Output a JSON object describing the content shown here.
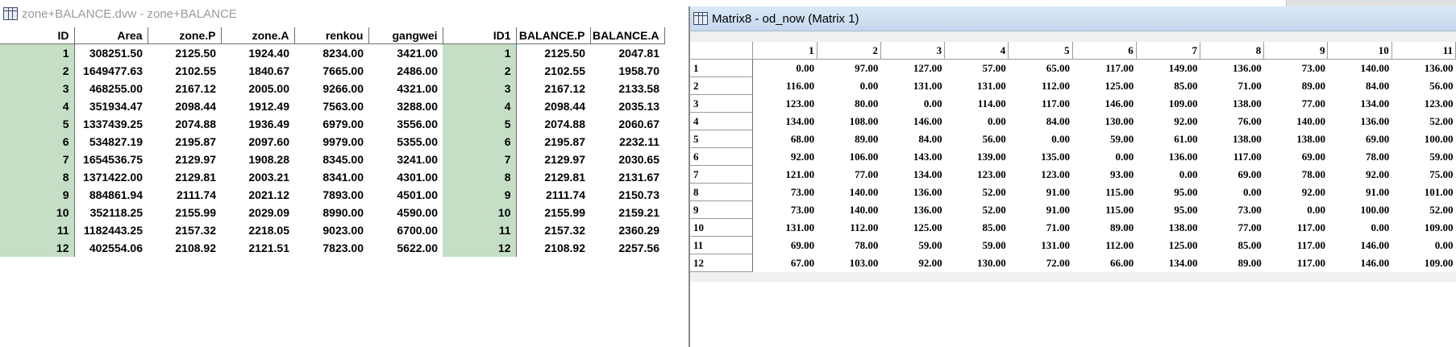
{
  "left_window": {
    "title": "zone+BALANCE.dvw - zone+BALANCE",
    "columns": [
      "ID",
      "Area",
      "zone.P",
      "zone.A",
      "renkou",
      "gangwei",
      "ID1",
      "BALANCE.P",
      "BALANCE.A"
    ],
    "rows": [
      [
        "1",
        "308251.50",
        "2125.50",
        "1924.40",
        "8234.00",
        "3421.00",
        "1",
        "2125.50",
        "2047.81"
      ],
      [
        "2",
        "1649477.63",
        "2102.55",
        "1840.67",
        "7665.00",
        "2486.00",
        "2",
        "2102.55",
        "1958.70"
      ],
      [
        "3",
        "468255.00",
        "2167.12",
        "2005.00",
        "9266.00",
        "4321.00",
        "3",
        "2167.12",
        "2133.58"
      ],
      [
        "4",
        "351934.47",
        "2098.44",
        "1912.49",
        "7563.00",
        "3288.00",
        "4",
        "2098.44",
        "2035.13"
      ],
      [
        "5",
        "1337439.25",
        "2074.88",
        "1936.49",
        "6979.00",
        "3556.00",
        "5",
        "2074.88",
        "2060.67"
      ],
      [
        "6",
        "534827.19",
        "2195.87",
        "2097.60",
        "9979.00",
        "5355.00",
        "6",
        "2195.87",
        "2232.11"
      ],
      [
        "7",
        "1654536.75",
        "2129.97",
        "1908.28",
        "8345.00",
        "3241.00",
        "7",
        "2129.97",
        "2030.65"
      ],
      [
        "8",
        "1371422.00",
        "2129.81",
        "2003.21",
        "8341.00",
        "4301.00",
        "8",
        "2129.81",
        "2131.67"
      ],
      [
        "9",
        "884861.94",
        "2111.74",
        "2021.12",
        "7893.00",
        "4501.00",
        "9",
        "2111.74",
        "2150.73"
      ],
      [
        "10",
        "352118.25",
        "2155.99",
        "2029.09",
        "8990.00",
        "4590.00",
        "10",
        "2155.99",
        "2159.21"
      ],
      [
        "11",
        "1182443.25",
        "2157.32",
        "2218.05",
        "9023.00",
        "6700.00",
        "11",
        "2157.32",
        "2360.29"
      ],
      [
        "12",
        "402554.06",
        "2108.92",
        "2121.51",
        "7823.00",
        "5622.00",
        "12",
        "2108.92",
        "2257.56"
      ]
    ]
  },
  "right_window": {
    "title": "Matrix8 - od_now (Matrix 1)",
    "columns": [
      "1",
      "2",
      "3",
      "4",
      "5",
      "6",
      "7",
      "8",
      "9",
      "10",
      "11"
    ],
    "row_labels": [
      "1",
      "2",
      "3",
      "4",
      "5",
      "6",
      "7",
      "8",
      "9",
      "10",
      "11",
      "12"
    ],
    "rows": [
      [
        "0.00",
        "97.00",
        "127.00",
        "57.00",
        "65.00",
        "117.00",
        "149.00",
        "136.00",
        "73.00",
        "140.00",
        "136.00"
      ],
      [
        "116.00",
        "0.00",
        "131.00",
        "131.00",
        "112.00",
        "125.00",
        "85.00",
        "71.00",
        "89.00",
        "84.00",
        "56.00"
      ],
      [
        "123.00",
        "80.00",
        "0.00",
        "114.00",
        "117.00",
        "146.00",
        "109.00",
        "138.00",
        "77.00",
        "134.00",
        "123.00"
      ],
      [
        "134.00",
        "108.00",
        "146.00",
        "0.00",
        "84.00",
        "130.00",
        "92.00",
        "76.00",
        "140.00",
        "136.00",
        "52.00"
      ],
      [
        "68.00",
        "89.00",
        "84.00",
        "56.00",
        "0.00",
        "59.00",
        "61.00",
        "138.00",
        "138.00",
        "69.00",
        "100.00"
      ],
      [
        "92.00",
        "106.00",
        "143.00",
        "139.00",
        "135.00",
        "0.00",
        "136.00",
        "117.00",
        "69.00",
        "78.00",
        "59.00"
      ],
      [
        "121.00",
        "77.00",
        "134.00",
        "123.00",
        "123.00",
        "93.00",
        "0.00",
        "69.00",
        "78.00",
        "92.00",
        "75.00"
      ],
      [
        "73.00",
        "140.00",
        "136.00",
        "52.00",
        "91.00",
        "115.00",
        "95.00",
        "0.00",
        "92.00",
        "91.00",
        "101.00"
      ],
      [
        "73.00",
        "140.00",
        "136.00",
        "52.00",
        "91.00",
        "115.00",
        "95.00",
        "73.00",
        "0.00",
        "100.00",
        "52.00"
      ],
      [
        "131.00",
        "112.00",
        "125.00",
        "85.00",
        "71.00",
        "89.00",
        "138.00",
        "77.00",
        "117.00",
        "0.00",
        "109.00"
      ],
      [
        "69.00",
        "78.00",
        "59.00",
        "59.00",
        "131.00",
        "112.00",
        "125.00",
        "85.00",
        "117.00",
        "146.00",
        "0.00"
      ],
      [
        "67.00",
        "103.00",
        "92.00",
        "130.00",
        "72.00",
        "66.00",
        "134.00",
        "89.00",
        "117.00",
        "146.00",
        "109.00"
      ]
    ]
  },
  "colors": {
    "key_column_bg": "#c4dfc6",
    "right_titlebar": "#c5d8ee"
  }
}
